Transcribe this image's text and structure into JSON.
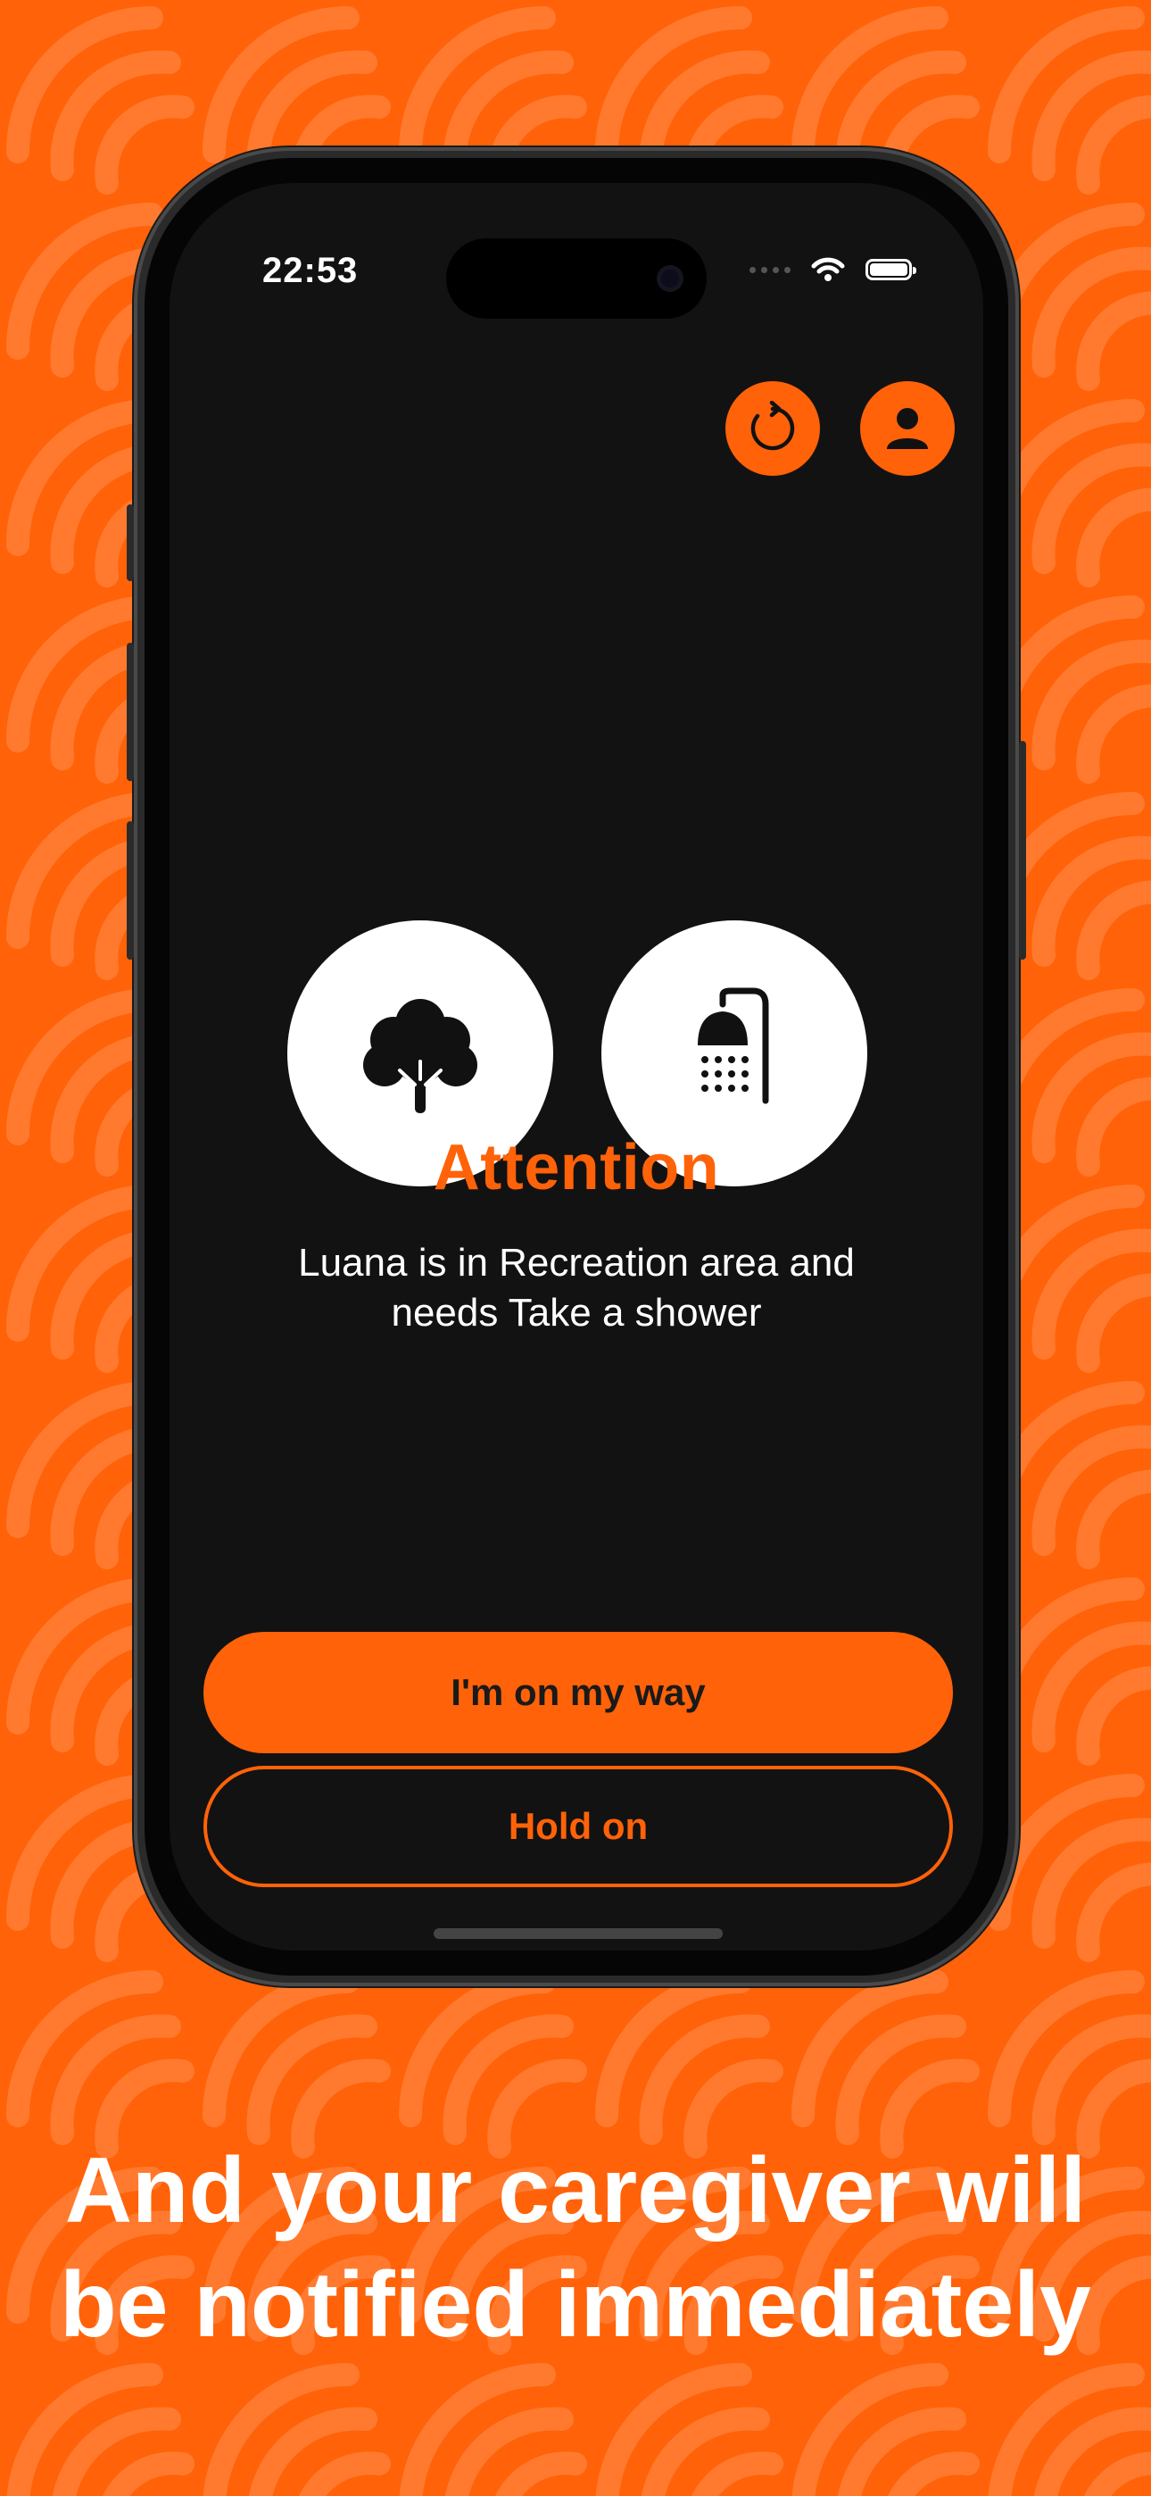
{
  "status_bar": {
    "time": "22:53"
  },
  "header": {
    "refresh_icon": "refresh-icon",
    "profile_icon": "person-icon"
  },
  "alert": {
    "location_icon": "tree-icon",
    "need_icon": "shower-icon",
    "title": "Attention",
    "message": "Luana is in Recreation area and needs Take a shower"
  },
  "actions": {
    "primary_label": "I'm on my way",
    "secondary_label": "Hold on"
  },
  "caption": {
    "line1": "And your caregiver will",
    "line2": "be notified immediately"
  },
  "colors": {
    "brand_orange": "#ff6208",
    "screen_background": "#121212",
    "text_primary": "#ffffff"
  }
}
